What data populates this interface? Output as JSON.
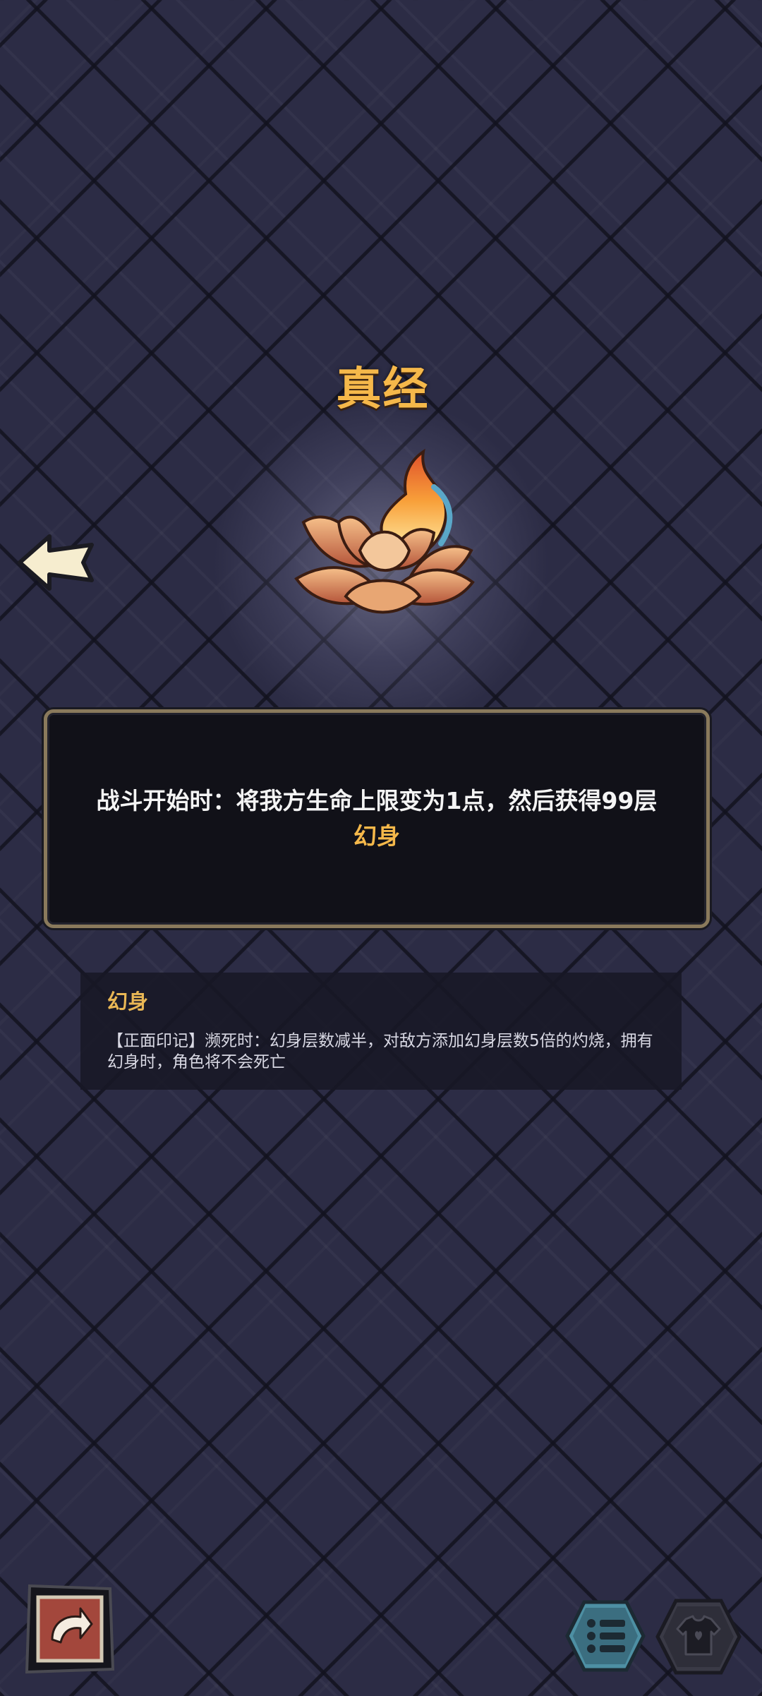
{
  "relic": {
    "name": "真经",
    "icon": "flaming-lotus-icon",
    "description": {
      "before": "战斗开始时：将我方生命上限变为1点，然后获得99层",
      "keyword": "幻身"
    }
  },
  "keyword_info": {
    "title": "幻身",
    "text": "【正面印记】濒死时：幻身层数减半，对敌方添加幻身层数5倍的灼烧，拥有幻身时，角色将不会死亡"
  },
  "controls": {
    "back_icon": "back-arrow-icon",
    "bottom_left_icon": "return-arrow-icon",
    "list_icon": "list-icon",
    "shirt_icon": "shirt-icon"
  },
  "colors": {
    "accent_gold": "#f5b84a",
    "background": "#2c2c45",
    "panel": "#111118"
  }
}
